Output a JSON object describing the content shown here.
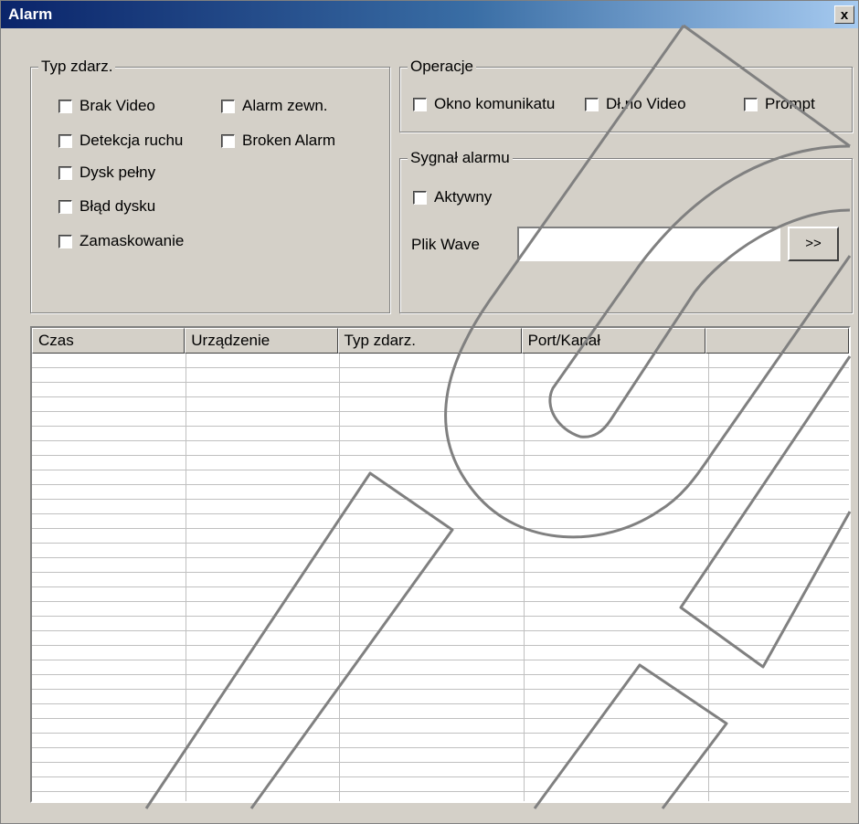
{
  "window": {
    "title": "Alarm",
    "close_label": "x"
  },
  "event_type_group": {
    "legend": "Typ zdarz.",
    "items": [
      "Brak Video",
      "Alarm zewn.",
      "Detekcja ruchu",
      "Broken Alarm",
      "Dysk pełny",
      "Błąd dysku",
      "Zamaskowanie"
    ]
  },
  "operations_group": {
    "legend": "Operacje",
    "items": [
      "Okno komunikatu",
      "Dł.no Video",
      "Prompt"
    ]
  },
  "alarm_signal_group": {
    "legend": "Sygnał alarmu",
    "active_label": "Aktywny",
    "wave_label": "Plik Wave",
    "wave_value": "",
    "browse_label": ">>"
  },
  "table": {
    "columns": [
      "Czas",
      "Urządzenie",
      "Typ zdarz.",
      "Port/Kanał",
      ""
    ],
    "rows": []
  },
  "colors": {
    "titlebar_start": "#0a246a",
    "face": "#d4d0c8"
  },
  "icons": {
    "watermark": "wrench-watermark-icon"
  }
}
